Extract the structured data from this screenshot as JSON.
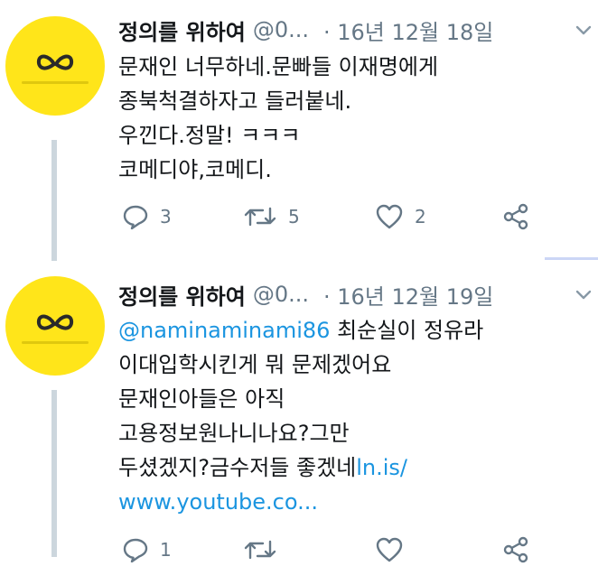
{
  "tweets": [
    {
      "name": "정의를 위하여",
      "handle": "@0...",
      "date": "· 16년 12월 18일",
      "lines": [
        "문재인 너무하네.문빠들 이재명에게",
        "종북척결하자고 들러붙네.",
        "우낀다.정말! ㅋㅋㅋ",
        "코메디야,코메디."
      ],
      "reply_count": "3",
      "retweet_count": "5",
      "like_count": "2"
    },
    {
      "name": "정의를 위하여",
      "handle": "@0...",
      "date": "· 16년 12월 19일",
      "mention": "@naminaminami86",
      "line1_text": " 최순실이 정유라",
      "line2": "이대입학시킨게 뭐 문제겠어요",
      "line3": "문재인아들은 아직",
      "line4": "고용정보원나니나요?그만",
      "line5_text": "두셨겠지?금수저들 좋겠네",
      "line5_link": "ln.is/",
      "line6_link": "www.youtube.co...",
      "reply_count": "1",
      "retweet_count": "",
      "like_count": ""
    }
  ],
  "icons": {
    "avatar_logo": "yellow-butterfly-logo",
    "more": "chevron-down-icon",
    "reply": "reply-icon",
    "retweet": "retweet-icon",
    "like": "heart-icon",
    "share": "share-icon"
  },
  "colors": {
    "text": "#14171a",
    "secondary": "#657786",
    "link": "#1b95e0",
    "thread_line": "#ccd6dd",
    "avatar_bg": "#ffe51a"
  }
}
